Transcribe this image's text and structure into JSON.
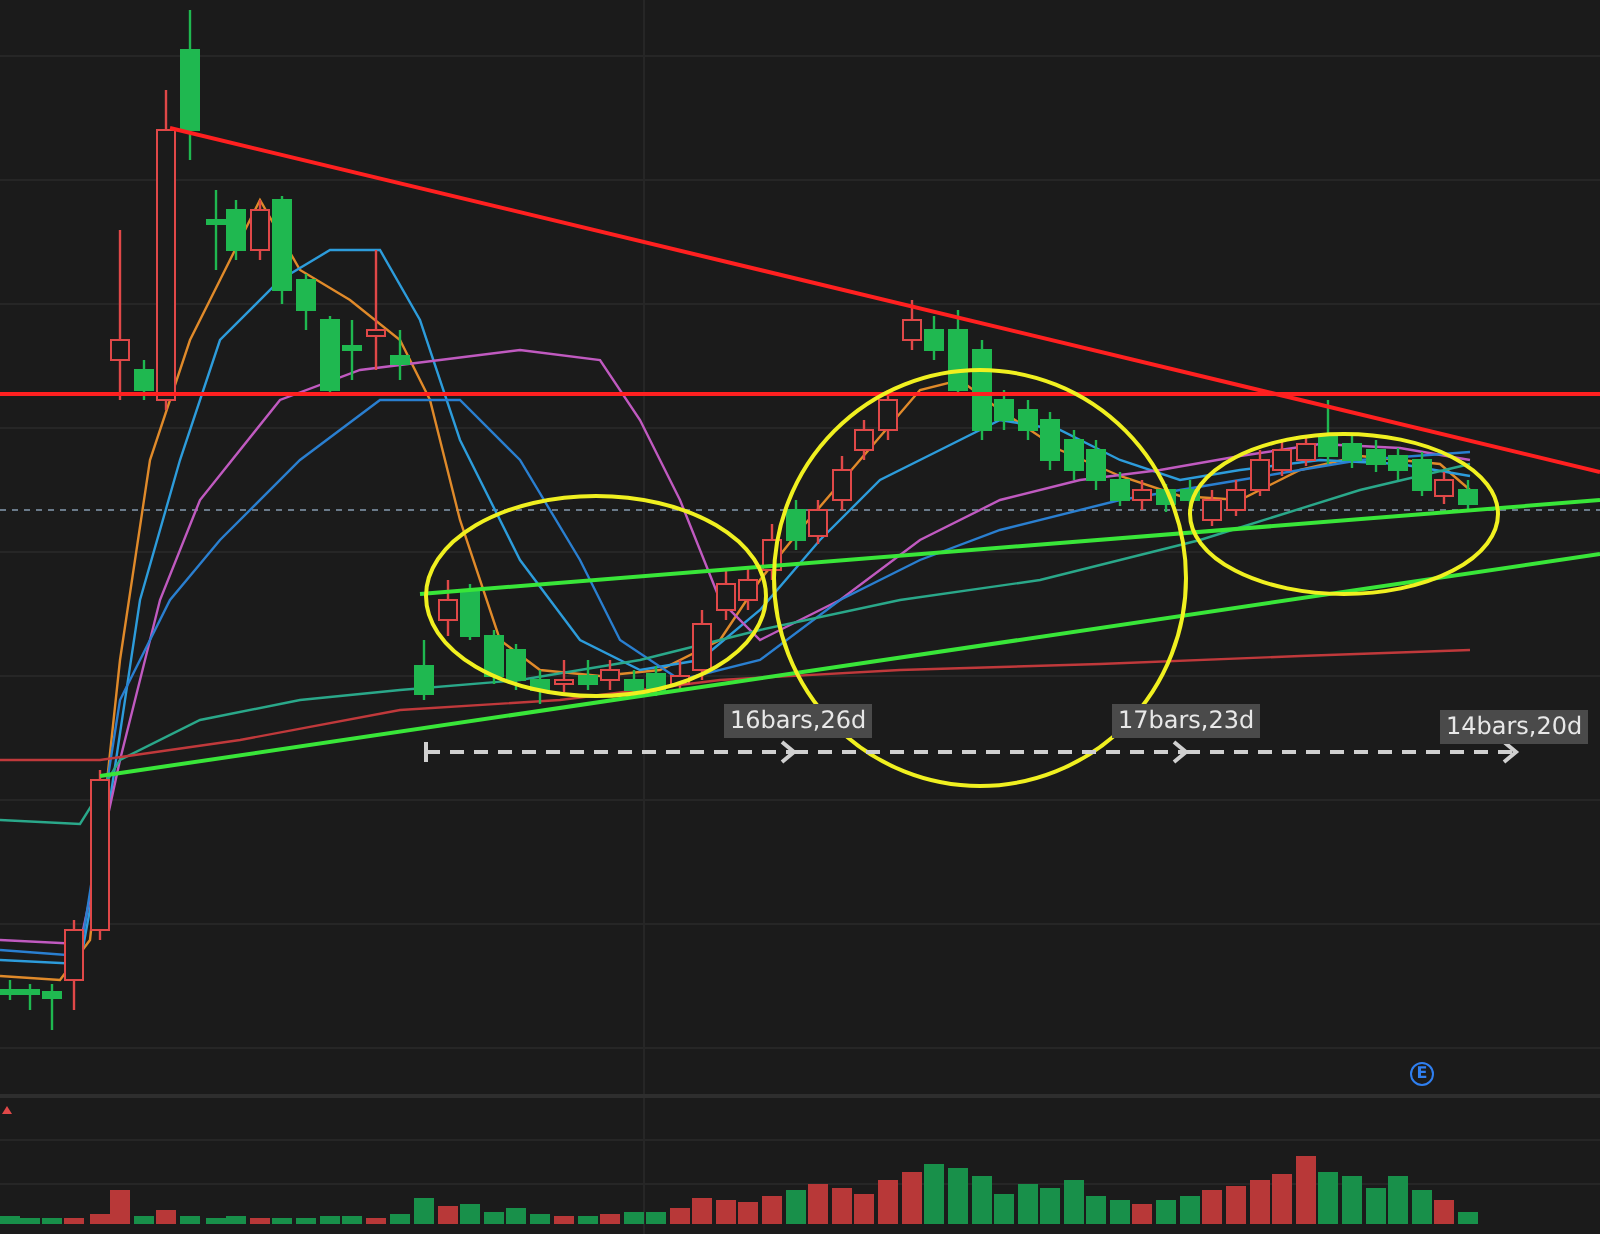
{
  "measurements": [
    {
      "label": "16bars,26d"
    },
    {
      "label": "17bars,23d"
    },
    {
      "label": "14bars,20d"
    }
  ],
  "event_marker": "E"
}
